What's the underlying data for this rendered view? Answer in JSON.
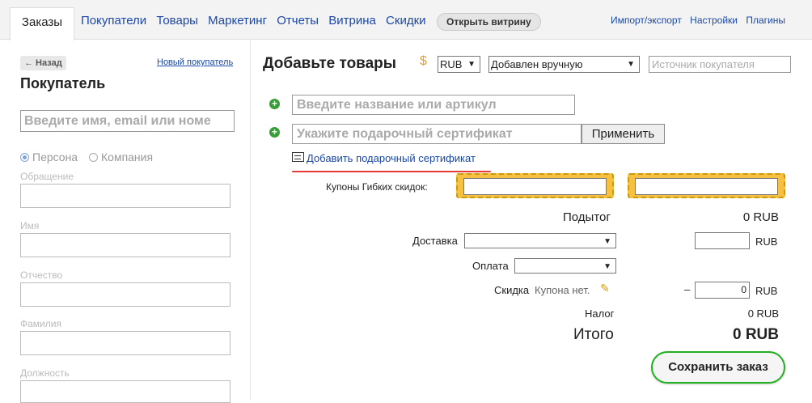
{
  "nav": {
    "active_tab": "Заказы",
    "links": [
      "Покупатели",
      "Товары",
      "Маркетинг",
      "Отчеты",
      "Витрина",
      "Скидки"
    ],
    "storefront_button": "Открыть витрину",
    "right_links": [
      "Импорт/экспорт",
      "Настройки",
      "Плагины"
    ]
  },
  "customer": {
    "back_label": "← Назад",
    "new_customer_link": "Новый покупатель",
    "title": "Покупатель",
    "search_placeholder": "Введите имя, email или номе",
    "type_person": "Персона",
    "type_company": "Компания",
    "fields": [
      "Обращение",
      "Имя",
      "Отчество",
      "Фамилия",
      "Должность"
    ]
  },
  "order": {
    "title": "Добавьте товары",
    "currency": "RUB",
    "source_select": "Добавлен вручную",
    "source_placeholder": "Источник покупателя",
    "product_placeholder": "Введите название или артикул",
    "certificate_placeholder": "Укажите подарочный сертификат",
    "apply_button": "Применить",
    "add_certificate_link": "Добавить подарочный сертификат",
    "coupons_label": "Купоны Гибких скидок:",
    "subtotal_label": "Подытог",
    "subtotal_value": "0 RUB",
    "delivery_label": "Доставка",
    "currency_suffix": "RUB",
    "payment_label": "Оплата",
    "discount_label": "Скидка",
    "discount_note": "Купона нет.",
    "discount_minus": "–",
    "discount_value": "0",
    "tax_label": "Налог",
    "tax_value": "0 RUB",
    "total_label": "Итого",
    "total_value": "0 RUB",
    "save_button": "Сохранить заказ"
  },
  "colors": {
    "link": "#1a47a8",
    "add_icon": "#3a9d3a",
    "coupon_highlight": "#f6c142",
    "annotation_line": "#e53935",
    "save_border": "#22b022"
  }
}
